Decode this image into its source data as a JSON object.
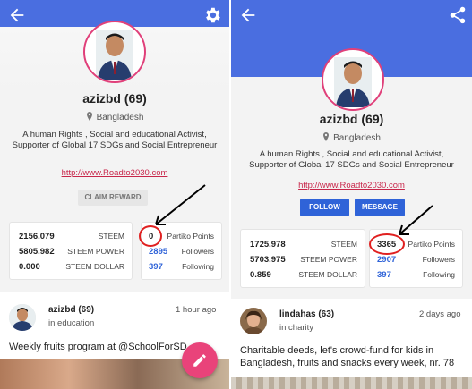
{
  "left": {
    "profile": {
      "name": "azizbd (69)",
      "location": "Bangladesh",
      "bio": "A human Rights , Social and educational Activist, Supporter of Global 17 SDGs and Social Entrepreneur",
      "link": "http://www.Roadto2030.com",
      "claim_label": "CLAIM REWARD"
    },
    "wallet": [
      {
        "value": "2156.079",
        "label": "STEEM"
      },
      {
        "value": "5805.982",
        "label": "STEEM POWER"
      },
      {
        "value": "0.000",
        "label": "STEEM DOLLAR"
      }
    ],
    "stats": [
      {
        "value": "0",
        "label": "Partiko Points",
        "color": "black"
      },
      {
        "value": "2895",
        "label": "Followers",
        "color": "blue"
      },
      {
        "value": "397",
        "label": "Following",
        "color": "blue"
      }
    ],
    "post": {
      "author": "azizbd (69)",
      "category": "in education",
      "time": "1 hour ago",
      "title": "Weekly fruits program at @SchoolForSD..."
    }
  },
  "right": {
    "profile": {
      "name": "azizbd (69)",
      "location": "Bangladesh",
      "bio": "A human Rights , Social and educational Activist, Supporter of Global 17 SDGs and Social Entrepreneur",
      "link": "http://www.Roadto2030.com",
      "follow_label": "FOLLOW",
      "message_label": "MESSAGE"
    },
    "wallet": [
      {
        "value": "1725.978",
        "label": "STEEM"
      },
      {
        "value": "5703.975",
        "label": "STEEM POWER"
      },
      {
        "value": "0.859",
        "label": "STEEM DOLLAR"
      }
    ],
    "stats": [
      {
        "value": "3365",
        "label": "Partiko Points",
        "color": "black"
      },
      {
        "value": "2907",
        "label": "Followers",
        "color": "blue"
      },
      {
        "value": "397",
        "label": "Following",
        "color": "blue"
      }
    ],
    "post": {
      "author": "lindahas (63)",
      "category": "in charity",
      "time": "2 days ago",
      "title": "Charitable deeds, let's crowd-fund for kids in Bangladesh, fruits and snacks every week, nr. 78"
    }
  },
  "colors": {
    "accent": "#4a6ee0",
    "brand_pink": "#e9437a",
    "link": "#c8264a",
    "highlight": "#e02020"
  },
  "icons": [
    "back-arrow-icon",
    "settings-gear-icon",
    "share-icon",
    "location-pin-icon",
    "edit-pencil-icon"
  ]
}
